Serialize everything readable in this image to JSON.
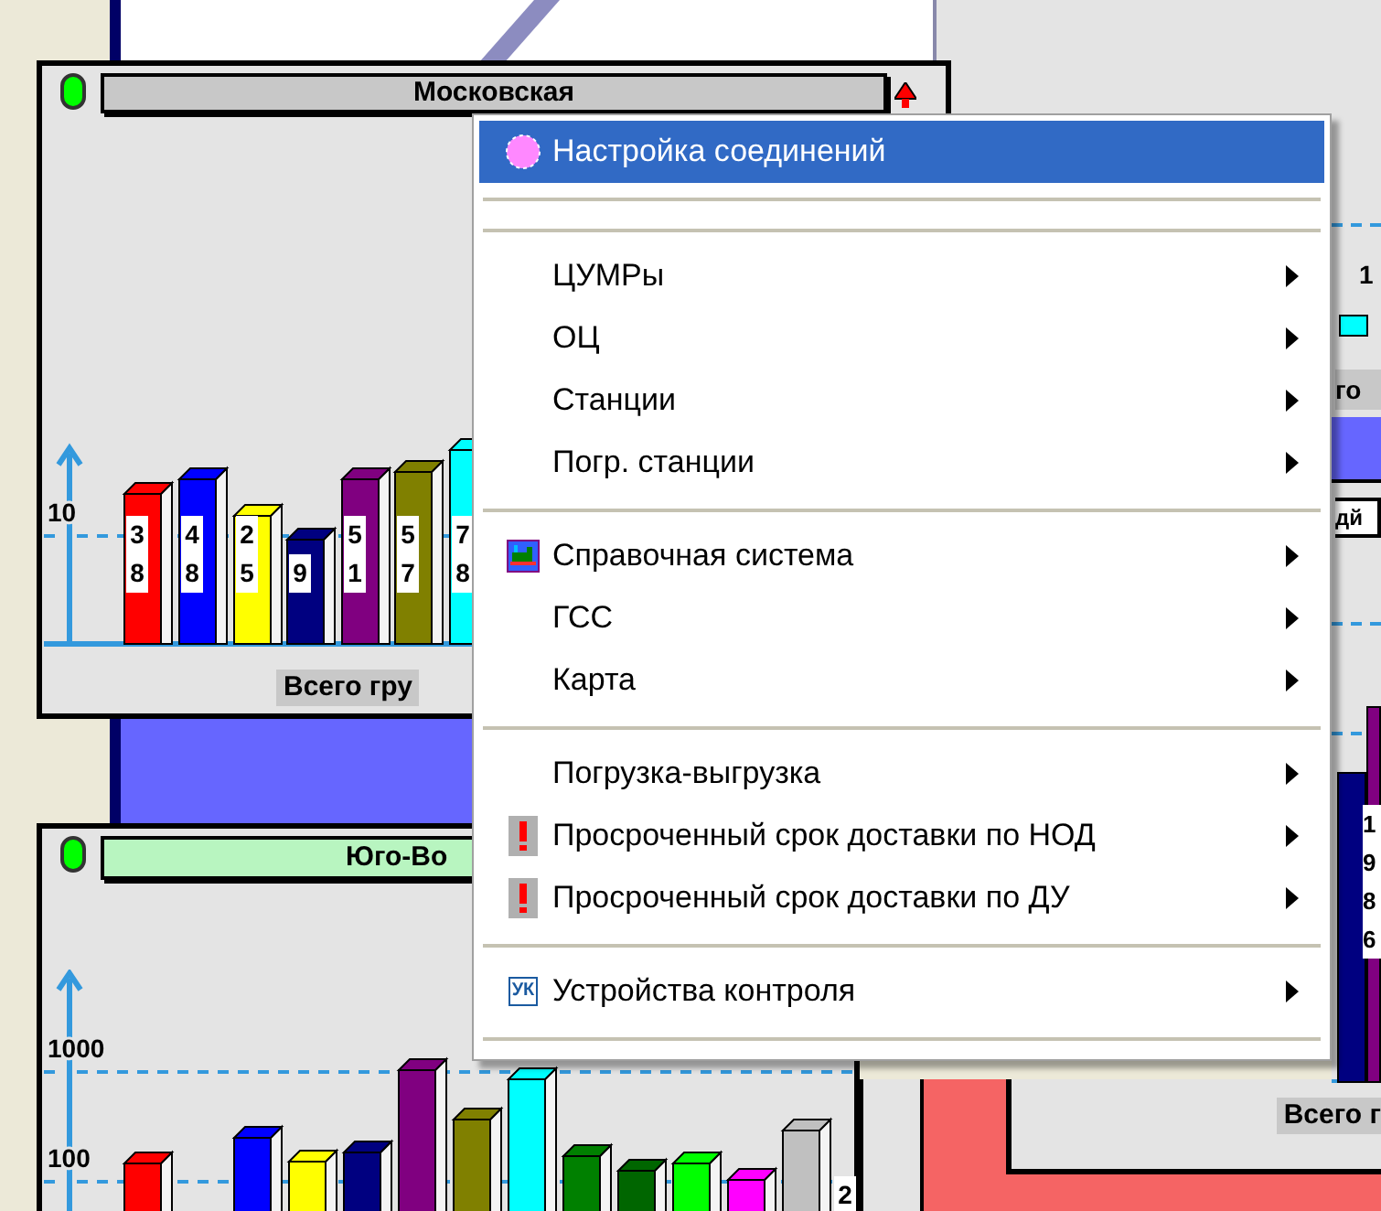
{
  "top_panel": {
    "title": "Московская",
    "tick_labels": [
      "10"
    ],
    "bar_labels": [
      "38",
      "48",
      "25",
      "9",
      "51",
      "57",
      "78"
    ],
    "footer": "Всего гру"
  },
  "bottom_panel": {
    "title": "Юго-Во",
    "tick_labels": [
      "1000",
      "100"
    ],
    "bar_label": "2"
  },
  "right_panel": {
    "tick_label": "1",
    "title_fragment": "го",
    "label_fragment": "дй",
    "data_label": "1986"
  },
  "bottom_right_panel": {
    "footer": "Всего г"
  },
  "context_menu": {
    "items": [
      {
        "kind": "item",
        "label": "Настройка соединений",
        "submenu": false,
        "selected": true
      },
      {
        "kind": "separator"
      },
      {
        "kind": "separator"
      },
      {
        "kind": "item",
        "label": "ЦУМРы",
        "submenu": true,
        "selected": false
      },
      {
        "kind": "item",
        "label": "ОЦ",
        "submenu": true,
        "selected": false
      },
      {
        "kind": "item",
        "label": "Станции",
        "submenu": true,
        "selected": false
      },
      {
        "kind": "item",
        "label": "Погр. станции",
        "submenu": true,
        "selected": false
      },
      {
        "kind": "separator"
      },
      {
        "kind": "item",
        "label": "Справочная система",
        "submenu": true,
        "selected": false
      },
      {
        "kind": "item",
        "label": "ГСС",
        "submenu": true,
        "selected": false
      },
      {
        "kind": "item",
        "label": "Карта",
        "submenu": true,
        "selected": false
      },
      {
        "kind": "separator"
      },
      {
        "kind": "item",
        "label": "Погрузка-выгрузка",
        "submenu": true,
        "selected": false
      },
      {
        "kind": "item",
        "label": "Просроченный срок доставки по НОД",
        "submenu": true,
        "selected": false
      },
      {
        "kind": "item",
        "label": "Просроченный срок доставки по ДУ",
        "submenu": true,
        "selected": false
      },
      {
        "kind": "separator"
      },
      {
        "kind": "item",
        "label": "Устройства контроля",
        "badge": "УК",
        "submenu": true,
        "selected": false
      },
      {
        "kind": "separator"
      }
    ]
  }
}
